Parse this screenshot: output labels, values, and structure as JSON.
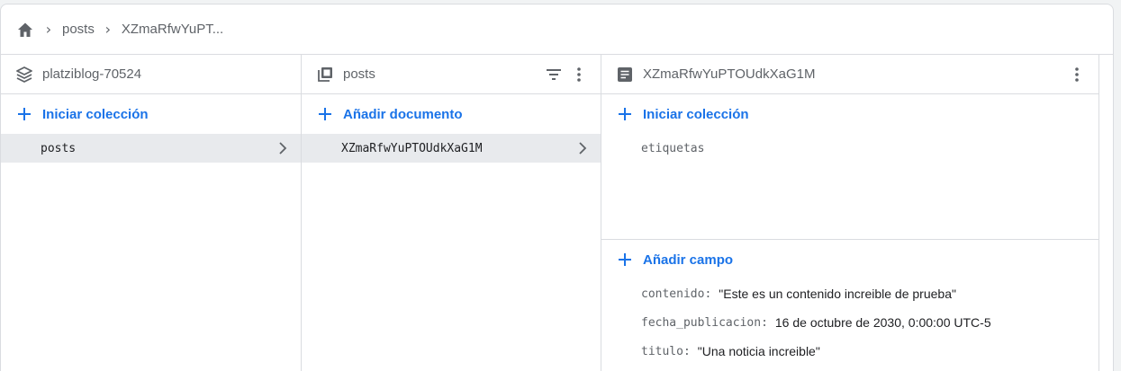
{
  "breadcrumb": {
    "items": [
      "posts",
      "XZmaRfwYuPT..."
    ]
  },
  "panel_root": {
    "title": "platziblog-70524",
    "action_label": "Iniciar colección",
    "items": [
      {
        "label": "posts",
        "selected": true
      }
    ]
  },
  "panel_collection": {
    "title": "posts",
    "action_label": "Añadir documento",
    "items": [
      {
        "label": "XZmaRfwYuPTOUdkXaG1M",
        "selected": true
      }
    ]
  },
  "panel_document": {
    "title": "XZmaRfwYuPTOUdkXaG1M",
    "subcollection_action_label": "Iniciar colección",
    "subcollections": [
      "etiquetas"
    ],
    "field_action_label": "Añadir campo",
    "fields": [
      {
        "key": "contenido",
        "value": "\"Este es un contenido increible de prueba\""
      },
      {
        "key": "fecha_publicacion",
        "value": "16 de octubre de 2030, 0:00:00 UTC-5"
      },
      {
        "key": "titulo",
        "value": "\"Una noticia increible\""
      }
    ]
  },
  "colors": {
    "accent": "#1a73e8",
    "selected_row": "#e8eaed",
    "border": "#dadce0"
  }
}
